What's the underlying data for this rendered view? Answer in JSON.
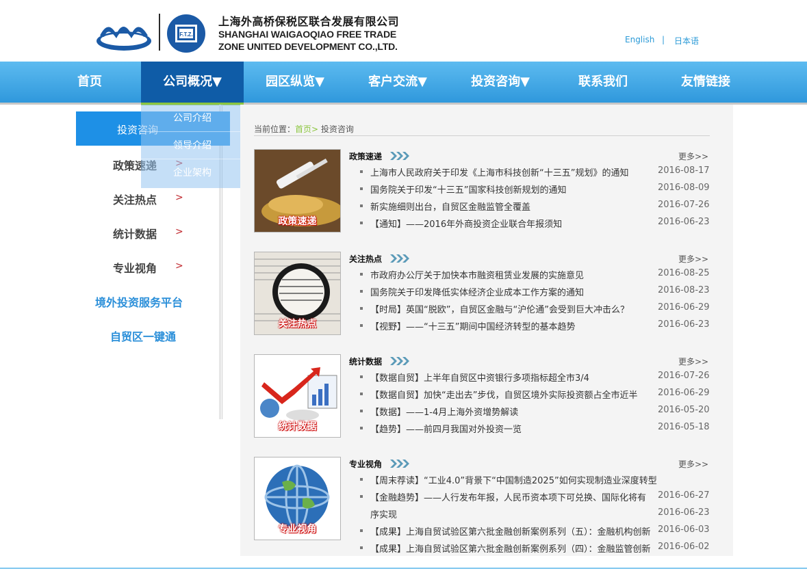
{
  "header": {
    "company_cn": "上海外高桥保税区联合发展有限公司",
    "company_en_line1": "SHANGHAI WAIGAOQIAO FREE TRADE",
    "company_en_line2": "ZONE UNITED DEVELOPMENT CO.,LTD.",
    "ftz_text": "F.T.Z.",
    "lang_english": "English",
    "lang_sep": "|",
    "lang_japanese": "日本语"
  },
  "nav": {
    "items": [
      {
        "label": "首页"
      },
      {
        "label": "公司概况▼"
      },
      {
        "label": "园区纵览▼"
      },
      {
        "label": "客户交流▼"
      },
      {
        "label": "投资咨询▼"
      },
      {
        "label": "联系我们"
      },
      {
        "label": "友情链接"
      }
    ],
    "dropdown": [
      "公司介绍",
      "领导介绍",
      "企业架构"
    ]
  },
  "sidebar": {
    "items": [
      {
        "label": "投资咨询",
        "arrow": ">"
      },
      {
        "label": "政策速递",
        "arrow": ">"
      },
      {
        "label": "关注热点",
        "arrow": ">"
      },
      {
        "label": "统计数据",
        "arrow": ">"
      },
      {
        "label": "专业视角",
        "arrow": ">"
      }
    ],
    "links": [
      "境外投资服务平台",
      "自贸区一键通"
    ]
  },
  "breadcrumb": {
    "prefix": "当前位置：",
    "home": "首页",
    "sep": ">",
    "current": "投资咨询"
  },
  "sections": [
    {
      "title": "政策速递",
      "image_label": "政策速递",
      "more": "更多>>",
      "news": [
        {
          "text": "上海市人民政府关于印发《上海市科技创新“十三五”规划》的通知",
          "date": "2016-08-17"
        },
        {
          "text": "国务院关于印发“十三五”国家科技创新规划的通知",
          "date": "2016-08-09"
        },
        {
          "text": "新实施细则出台，自贸区金融监管全覆盖",
          "date": "2016-07-26"
        },
        {
          "text": "【通知】——2016年外商投资企业联合年报须知",
          "date": "2016-06-23"
        }
      ]
    },
    {
      "title": "关注热点",
      "image_label": "关注热点",
      "more": "更多>>",
      "news": [
        {
          "text": "市政府办公厅关于加快本市融资租赁业发展的实施意见",
          "date": "2016-08-25"
        },
        {
          "text": "国务院关于印发降低实体经济企业成本工作方案的通知",
          "date": "2016-08-23"
        },
        {
          "text": "【时局】英国“脱欧”，自贸区金融与“沪伦通”会受到巨大冲击么？",
          "date": "2016-06-29"
        },
        {
          "text": "【视野】——“十三五”期间中国经济转型的基本趋势",
          "date": "2016-06-23"
        }
      ]
    },
    {
      "title": "统计数据",
      "image_label": "统计数据",
      "more": "更多>>",
      "news": [
        {
          "text": "【数据自贸】上半年自贸区中资银行多项指标超全市3/4",
          "date": "2016-07-26"
        },
        {
          "text": "【数据自贸】加快“走出去”步伐，自贸区境外实际投资额占全市近半",
          "date": "2016-06-29"
        },
        {
          "text": "【数据】——1-4月上海外资增势解读",
          "date": "2016-05-20"
        },
        {
          "text": "【趋势】——前四月我国对外投资一览",
          "date": "2016-05-18"
        }
      ]
    },
    {
      "title": "专业视角",
      "image_label": "专业视角",
      "more": "更多>>",
      "news": [
        {
          "text": "【周末荐读】“工业4.0”背景下“中国制造2025”如何实现制造业深度转型",
          "date": ""
        },
        {
          "text": "【金融趋势】——人行发布年报，人民币资本项下可兑换、国际化将有",
          "date": "2016-06-27"
        },
        {
          "text": "序实现",
          "date": "2016-06-23"
        },
        {
          "text": "【成果】上海自贸试验区第六批金融创新案例系列（五）：金融机构创新",
          "date": "2016-06-03"
        },
        {
          "text": "【成果】上海自贸试验区第六批金融创新案例系列（四）：金融监管创新",
          "date": "2016-06-02"
        }
      ]
    }
  ],
  "colors": {
    "nav_gradient_top": "#5dbbf0",
    "nav_gradient_bottom": "#2f98dc",
    "nav_active": "#0f5ca7",
    "accent_green": "#8cc63f",
    "sidebar_active": "#1e90e6",
    "link_blue": "#2b8fd9",
    "arrow_red": "#c0272d"
  }
}
